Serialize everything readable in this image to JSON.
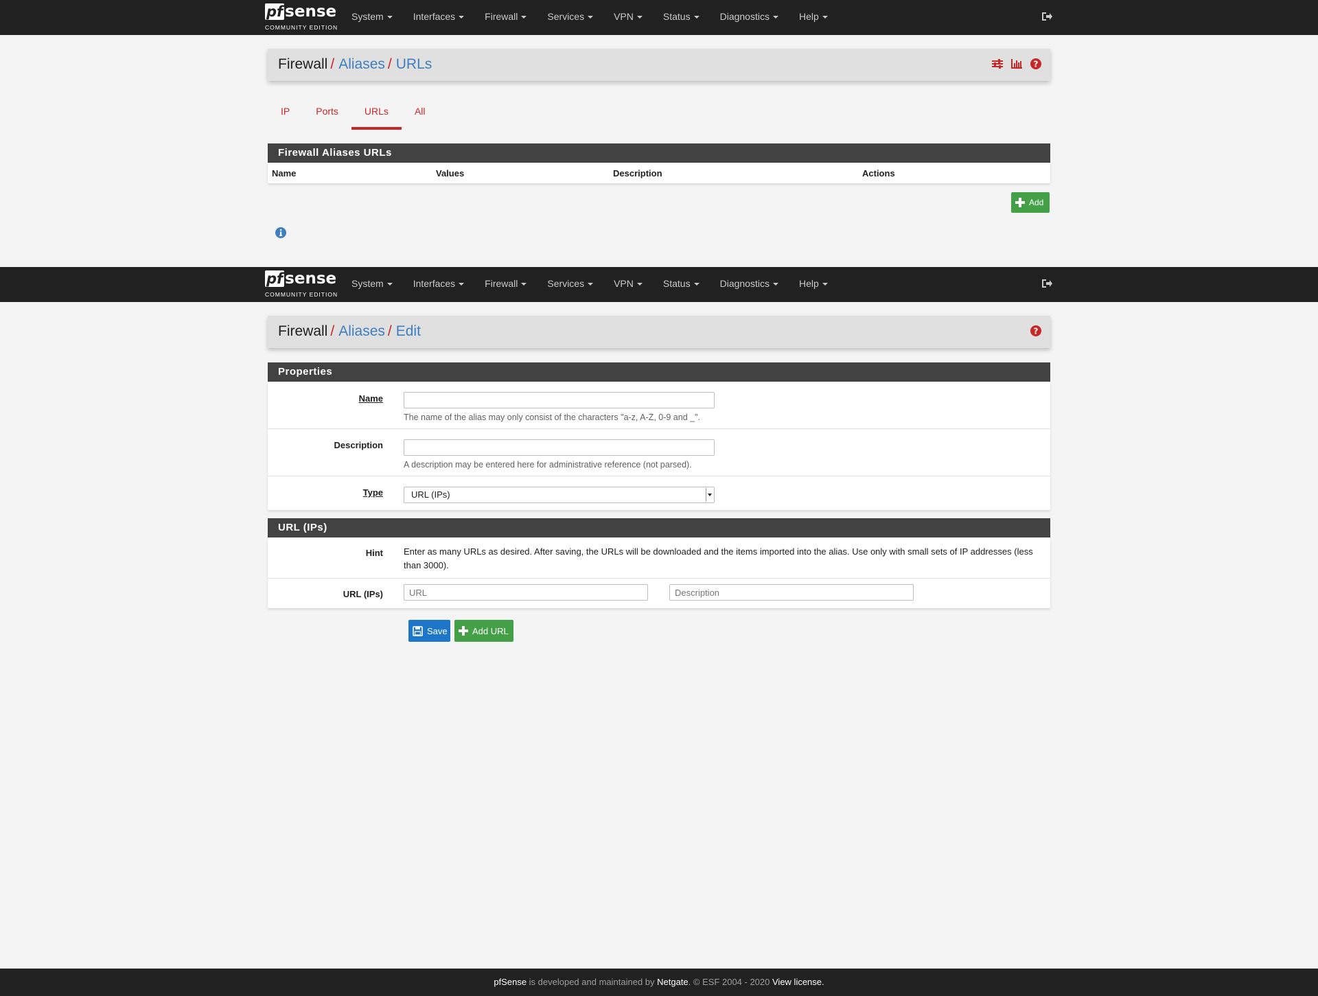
{
  "brand": {
    "main_pf": "pf",
    "main_sense": "sense",
    "sub": "COMMUNITY EDITION"
  },
  "nav": {
    "items": [
      "System",
      "Interfaces",
      "Firewall",
      "Services",
      "VPN",
      "Status",
      "Diagnostics",
      "Help"
    ],
    "logout_icon": "sign-out-icon"
  },
  "top_view": {
    "breadcrumb": {
      "first": "Firewall",
      "second": "Aliases",
      "third": "URLs",
      "sep": "/"
    },
    "icons": [
      "sliders-icon",
      "bar-chart-icon",
      "question-circle-icon"
    ],
    "tabs": [
      {
        "label": "IP",
        "active": false
      },
      {
        "label": "Ports",
        "active": false
      },
      {
        "label": "URLs",
        "active": true
      },
      {
        "label": "All",
        "active": false
      }
    ],
    "panel_title": "Firewall Aliases URLs",
    "columns": [
      "Name",
      "Values",
      "Description",
      "Actions"
    ],
    "add_button": "Add",
    "info_icon": "info-circle-icon"
  },
  "bottom_view": {
    "breadcrumb": {
      "first": "Firewall",
      "second": "Aliases",
      "third": "Edit",
      "sep": "/"
    },
    "help_icon": "question-circle-icon",
    "properties": {
      "title": "Properties",
      "name_label": "Name",
      "name_value": "",
      "name_help": "The name of the alias may only consist of the characters \"a-z, A-Z, 0-9 and _\".",
      "description_label": "Description",
      "description_value": "",
      "description_help": "A description may be entered here for administrative reference (not parsed).",
      "type_label": "Type",
      "type_value": "URL (IPs)"
    },
    "url_section": {
      "title": "URL (IPs)",
      "hint_label": "Hint",
      "hint_text": "Enter as many URLs as desired. After saving, the URLs will be downloaded and the items imported into the alias. Use only with small sets of IP addresses (less than 3000).",
      "url_label": "URL (IPs)",
      "url_placeholder": "URL",
      "description_placeholder": "Description"
    },
    "save_button": "Save",
    "add_url_button": "Add URL"
  },
  "footer": {
    "product": "pfSense",
    "middle": " is developed and maintained by ",
    "company": "Netgate",
    "copyright": ". © ESF 2004 - 2020 ",
    "license": "View license."
  },
  "colors": {
    "navbar": "#212121",
    "accent_red": "#c62828",
    "link_blue": "#3f7fbf",
    "panel_heading": "#424242",
    "button_green": "#43a047",
    "button_blue": "#1e76c9"
  }
}
